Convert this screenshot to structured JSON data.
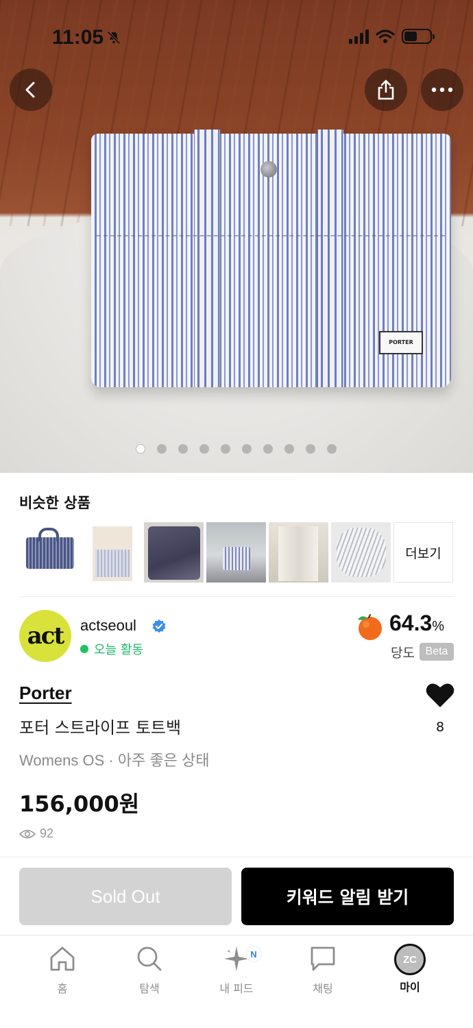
{
  "status_bar": {
    "time": "11:05"
  },
  "gallery": {
    "dot_count": 10,
    "active_index": 0,
    "bag_label": "PORTER"
  },
  "similar": {
    "title": "비슷한 상품",
    "more_label": "더보기"
  },
  "seller": {
    "avatar_text": "act",
    "name": "actseoul",
    "activity": "오늘 활동",
    "sugar_value": "64.3",
    "sugar_unit": "%",
    "sugar_label": "당도",
    "beta_label": "Beta"
  },
  "product": {
    "brand": "Porter",
    "name": "포터 스트라이프 토트백",
    "condition": "Womens OS · 아주 좋은 상태",
    "price": "156,000원",
    "views": "92",
    "likes": "8"
  },
  "actions": {
    "sold_out_label": "Sold Out",
    "keyword_alert_label": "키워드 알림 받기"
  },
  "tabbar": {
    "items": [
      {
        "label": "홈",
        "icon": "home-icon"
      },
      {
        "label": "탐색",
        "icon": "search-icon"
      },
      {
        "label": "내 피드",
        "icon": "sparkle-icon",
        "badge": "N"
      },
      {
        "label": "채팅",
        "icon": "chat-icon"
      },
      {
        "label": "마이",
        "icon": "avatar",
        "avatar_text": "ZC"
      }
    ]
  },
  "colors": {
    "accent_green": "#1fb86a",
    "avatar_yellow": "#d8e23a",
    "sold_out_gray": "#d3d3d3",
    "badge_blue": "#2f80ed"
  }
}
